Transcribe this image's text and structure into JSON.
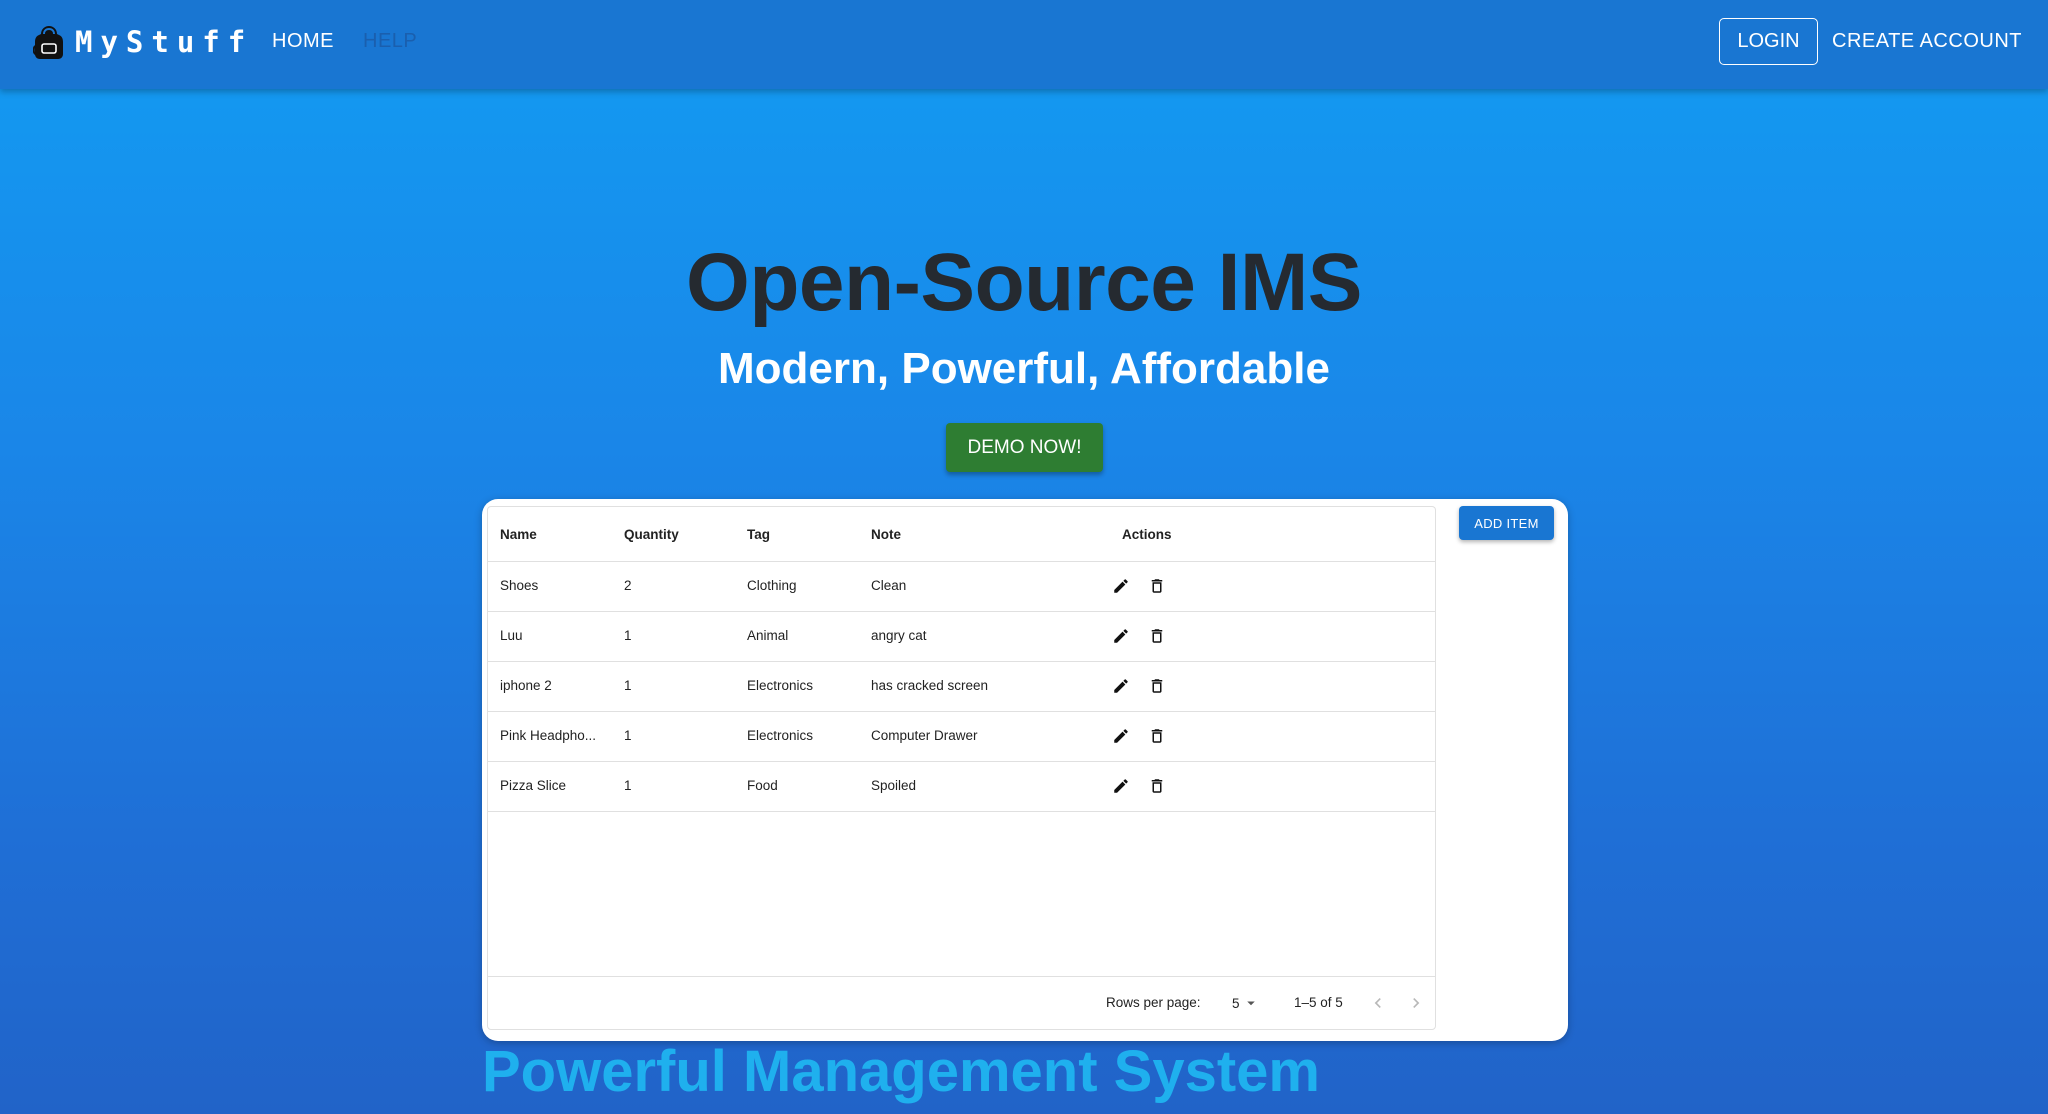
{
  "nav": {
    "brand": "MyStuff",
    "home": "HOME",
    "help": "HELP",
    "login": "LOGIN",
    "create_account": "CREATE ACCOUNT"
  },
  "hero": {
    "title": "Open-Source IMS",
    "subtitle": "Modern, Powerful, Affordable",
    "demo_button": "DEMO NOW!"
  },
  "table": {
    "columns": [
      "Name",
      "Quantity",
      "Tag",
      "Note",
      "Actions"
    ],
    "rows": [
      {
        "name": "Shoes",
        "quantity": "2",
        "tag": "Clothing",
        "note": "Clean"
      },
      {
        "name": "Luu",
        "quantity": "1",
        "tag": "Animal",
        "note": "angry cat"
      },
      {
        "name": "iphone 2",
        "quantity": "1",
        "tag": "Electronics",
        "note": "has cracked screen"
      },
      {
        "name": "Pink Headpho...",
        "quantity": "1",
        "tag": "Electronics",
        "note": "Computer Drawer"
      },
      {
        "name": "Pizza Slice",
        "quantity": "1",
        "tag": "Food",
        "note": "Spoiled"
      }
    ],
    "add_button": "ADD ITEM",
    "footer": {
      "rows_per_page_label": "Rows per page:",
      "rows_per_page_value": "5",
      "range": "1–5 of 5"
    },
    "icons": {
      "edit": "pencil-icon",
      "delete": "trash-icon",
      "prev": "chevron-left-icon",
      "next": "chevron-right-icon",
      "dropdown": "caret-down-icon"
    }
  },
  "section": {
    "title": "Powerful Management System"
  },
  "colors": {
    "navbar": "#1976d2",
    "demo_button": "#2e7d32",
    "add_button": "#1976d2",
    "hero_title": "#252a30",
    "section_title": "#1fb0ee"
  }
}
